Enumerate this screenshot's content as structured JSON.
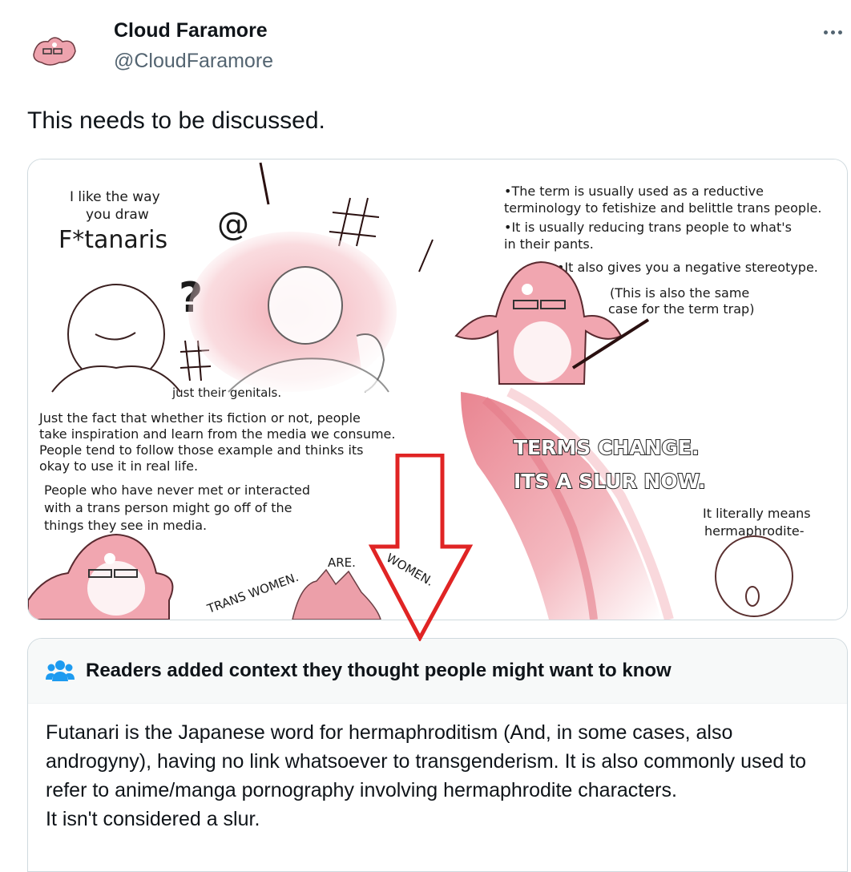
{
  "tweet": {
    "author_name": "Cloud Faramore",
    "author_handle": "@CloudFaramore",
    "text": "This needs to be discussed."
  },
  "comic": {
    "panel1": {
      "line1": "I like the way",
      "line2": "you draw",
      "line3": "F*tanaris"
    },
    "panel2": {
      "line1": "•The term is usually used as a reductive",
      "line2": "terminology to fetishize and belittle trans people.",
      "line3": "•It is usually reducing trans people to what's",
      "line4": "in their pants.",
      "line5": "•It also gives you a negative stereotype.",
      "line6": "(This is also the same",
      "line7": "case for the term trap)"
    },
    "panel3": {
      "cut_line": "just their genitals.",
      "line1": "Just the fact that whether its fiction or not, people",
      "line2": "take inspiration and learn from the media we consume.",
      "line3": "People tend to follow those example and thinks its",
      "line4": "okay to use it in real life.",
      "line5": "People who have never met or interacted",
      "line6": "with a trans person might go off of the",
      "line7": "things they see in media.",
      "w1": "TRANS WOMEN.",
      "w2": "ARE.",
      "w3": "WOMEN."
    },
    "panel4": {
      "shout1": "TERMS CHANGE.",
      "shout2": "ITS A SLUR NOW.",
      "line1": "It literally means",
      "line2": "hermaphrodite-"
    }
  },
  "note": {
    "title": "Readers added context they thought people might want to know",
    "body_line1": "Futanari is the Japanese word for hermaphroditism (And, in some cases, also androgyny), having no link whatsoever to transgenderism. It is also commonly used to refer to anime/manga pornography involving hermaphrodite characters.",
    "body_line2": "It isn't considered a slur."
  },
  "colors": {
    "accent_red": "#e02424",
    "pink": "#ee9aa4",
    "note_icon_blue": "#1d9bf0",
    "secondary_text": "#536471"
  },
  "icons": [
    "avatar-image",
    "more-options-icon",
    "people-icon",
    "red-down-arrow"
  ]
}
